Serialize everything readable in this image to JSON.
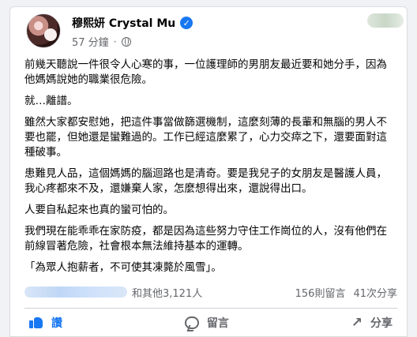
{
  "post": {
    "author_name": "穆熙妍 Crystal Mu",
    "timestamp": "57 分鐘",
    "dot": "·",
    "paragraphs": [
      "前幾天聽說一件很令人心寒的事，一位護理師的男朋友最近要和她分手，因為他媽媽說她的職業很危險。",
      "就…離譜。",
      "雖然大家都安慰她，把這件事當做篩選機制，這麼刻薄的長輩和無腦的男人不要也罷，但她還是蠻難過的。工作已經這麼累了，心力交瘁之下，還要面對這種破事。",
      "患難見人品，這個媽媽的腦迴路也是清奇。要是我兒子的女朋友是醫護人員，我心疼都來不及，還嫌棄人家，怎麼想得出來，還說得出口。",
      "人要自私起來也真的蠻可怕的。",
      "我們現在能乖乖在家防疫，都是因為這些努力守住工作崗位的人，沒有他們在前線冒著危險，社會根本無法維持基本的運轉。",
      "「為眾人抱薪者，不可使其凍斃於風雪」。"
    ],
    "reactions_text": "和其他3,121人",
    "comments_text": "156則留言",
    "shares_text": "41次分享",
    "actions": {
      "like": "讚",
      "comment": "留言",
      "share": "分享"
    },
    "icons": {
      "verified": "verified-check-icon",
      "globe": "globe-icon",
      "like": "like-icon",
      "comment": "comment-icon",
      "share": "share-icon"
    },
    "colors": {
      "accent": "#1877f2",
      "text": "#050505",
      "muted": "#65676b",
      "background": "#f0f2f5"
    }
  }
}
